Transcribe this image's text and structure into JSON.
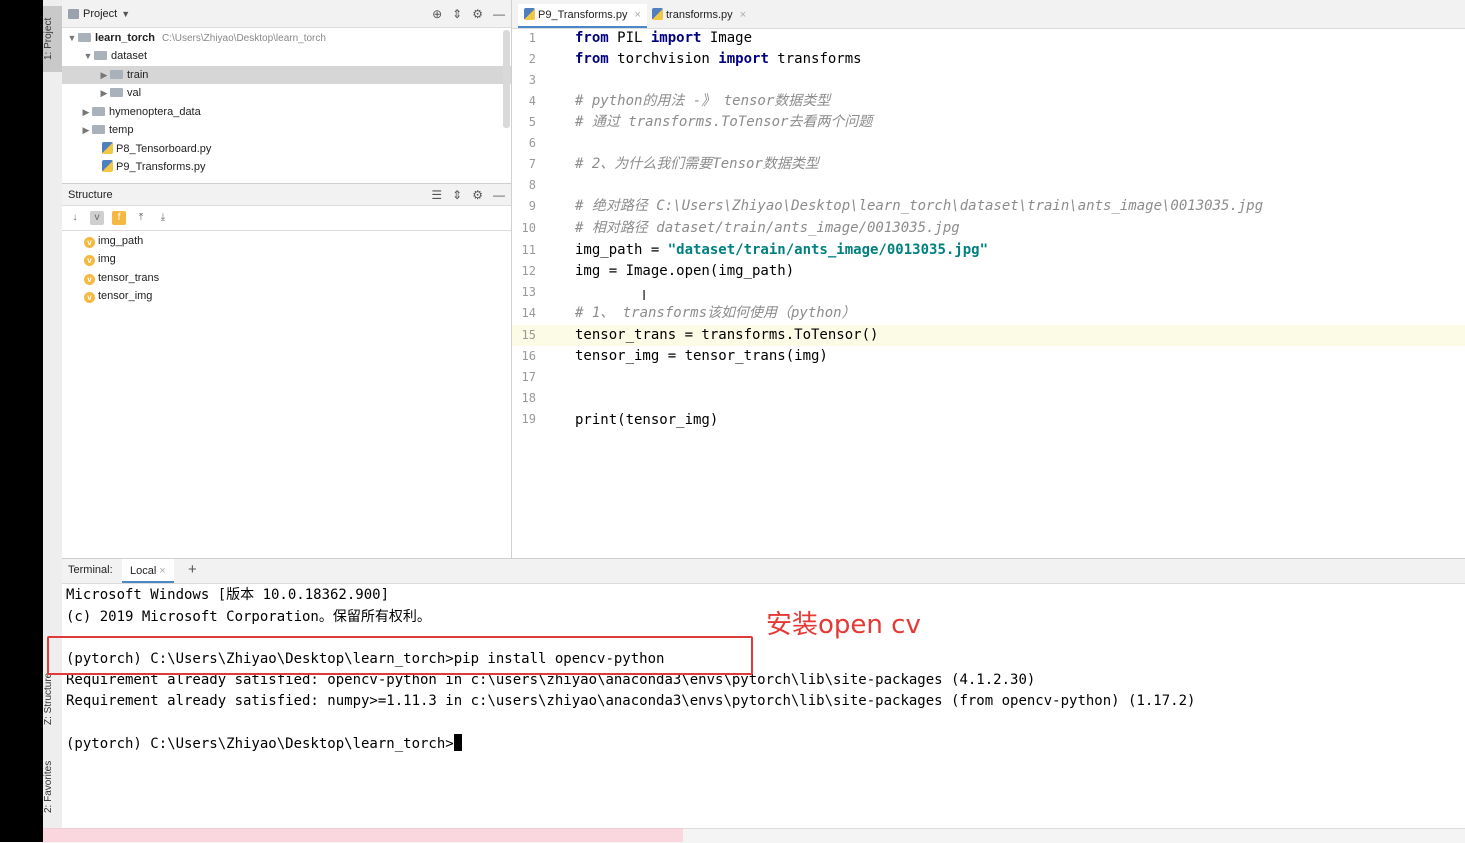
{
  "toolstrip": {
    "project_tab": "1: Project",
    "structure_tab": "Z: Structure",
    "favorites_tab": "2: Favorites"
  },
  "project_panel": {
    "title": "Project",
    "root_name": "learn_torch",
    "root_path": "C:\\Users\\Zhiyao\\Desktop\\learn_torch",
    "items": [
      {
        "label": "dataset"
      },
      {
        "label": "train"
      },
      {
        "label": "val"
      },
      {
        "label": "hymenoptera_data"
      },
      {
        "label": "temp"
      },
      {
        "label": "P8_Tensorboard.py"
      },
      {
        "label": "P9_Transforms.py"
      }
    ]
  },
  "structure_panel": {
    "title": "Structure",
    "items": [
      "img_path",
      "img",
      "tensor_trans",
      "tensor_img"
    ]
  },
  "editor": {
    "tabs": [
      "P9_Transforms.py",
      "transforms.py"
    ],
    "line_numbers": [
      "1",
      "2",
      "3",
      "4",
      "5",
      "6",
      "7",
      "8",
      "9",
      "10",
      "11",
      "12",
      "13",
      "14",
      "15",
      "16",
      "17",
      "18",
      "19"
    ],
    "lines": {
      "l1_kw1": "from",
      "l1_mod": " PIL ",
      "l1_kw2": "import",
      "l1_name": " Image",
      "l2_kw1": "from",
      "l2_mod": " torchvision ",
      "l2_kw2": "import",
      "l2_name": " transforms",
      "l4": "# python的用法 -》 tensor数据类型",
      "l5": "# 通过 transforms.ToTensor去看两个问题",
      "l7": "# 2、为什么我们需要Tensor数据类型",
      "l9": "# 绝对路径 C:\\Users\\Zhiyao\\Desktop\\learn_torch\\dataset\\train\\ants_image\\0013035.jpg",
      "l10": "# 相对路径 dataset/train/ants_image/0013035.jpg",
      "l11_a": "img_path = ",
      "l11_str": "\"dataset/train/ants_image/0013035.jpg\"",
      "l12": "img = Image.open(img_path)",
      "l14": "# 1、 transforms该如何使用（python）",
      "l15": "tensor_trans = transforms.ToTensor()",
      "l16": "tensor_img = tensor_trans(img)",
      "l19": "print(tensor_img)"
    }
  },
  "terminal": {
    "label": "Terminal:",
    "tab": "Local",
    "add": "+",
    "lines": [
      "Microsoft Windows [版本 10.0.18362.900]",
      "(c) 2019 Microsoft Corporation。保留所有权利。",
      "(pytorch) C:\\Users\\Zhiyao\\Desktop\\learn_torch>pip install opencv-python",
      "Requirement already satisfied: opencv-python in c:\\users\\zhiyao\\anaconda3\\envs\\pytorch\\lib\\site-packages (4.1.2.30)",
      "Requirement already satisfied: numpy>=1.11.3 in c:\\users\\zhiyao\\anaconda3\\envs\\pytorch\\lib\\site-packages (from opencv-python) (1.17.2)",
      "(pytorch) C:\\Users\\Zhiyao\\Desktop\\learn_torch>"
    ]
  },
  "annotation": {
    "text": "安装open cv",
    "color": "#e53935"
  },
  "colors": {
    "keyword": "#000080",
    "string": "#008080",
    "comment": "#8c8c8c",
    "accent": "#4a88c7"
  }
}
